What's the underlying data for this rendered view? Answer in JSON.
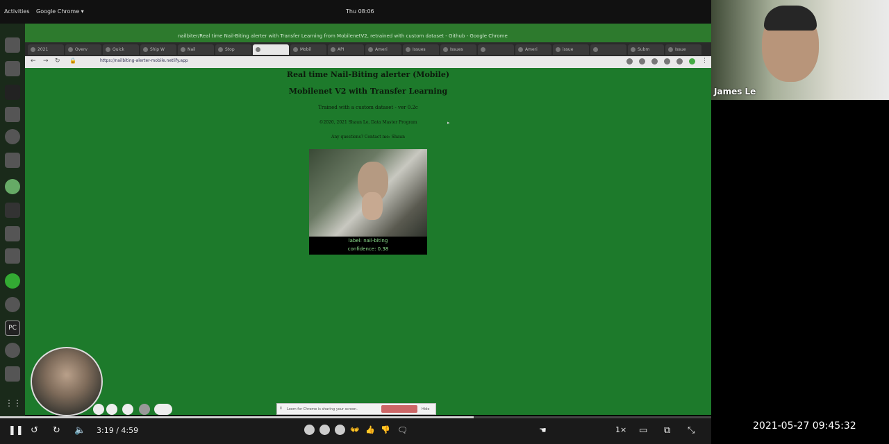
{
  "topbar": {
    "activities": "Activities",
    "app": "Google Chrome ▾",
    "clock": "Thu 08:06"
  },
  "window_title": "nailbiter/Real time Nail-Biting alerter with Transfer Learning from MobilenetV2, retrained with custom dataset - Github - Google Chrome",
  "tabs": [
    "2021",
    "Overv",
    "Quick",
    "Ship W",
    "Nail",
    "Stop",
    "",
    "Mobil",
    "API",
    "Ameri",
    "Issues",
    "Issues",
    "",
    "Ameri",
    "issue",
    "",
    "Subm",
    "Issue"
  ],
  "active_tab_index": 6,
  "address_bar": {
    "url": "https://nailbiting-alerter-mobile.netlify.app"
  },
  "page": {
    "title_line1": "Real time Nail-Biting alerter (Mobile)",
    "title_line2": "Mobilenet V2 with Transfer Learning",
    "subtitle": "Trained with a custom dataset - ver 0.2c",
    "credits": "©2020, 2021 Shaun Le, Data Master Program",
    "contact": "Any questions? Contact me: Shaun",
    "prediction_label": "label: nail-biting",
    "prediction_confidence": "confidence: 0.38"
  },
  "notification": {
    "text": "Loom for Chrome is sharing your screen.",
    "action": "Hide"
  },
  "player": {
    "current_time": "3:19",
    "duration": "4:59",
    "time_display": "3:19 / 4:59",
    "progress": 0.666,
    "speed": "1×"
  },
  "participant": {
    "name": "James Le"
  },
  "timestamp": "2021-05-27  09:45:32",
  "colors": {
    "page_bg": "#1d7a2b",
    "chrome_green": "#2d7a2d",
    "controls_bg": "#1a1a1a"
  }
}
